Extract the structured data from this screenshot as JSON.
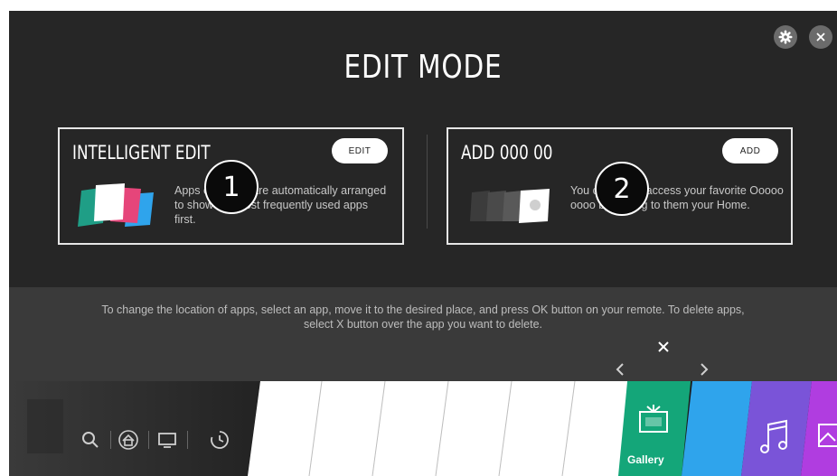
{
  "header": {
    "title": "EDIT MODE",
    "settings_icon": "gear-icon",
    "close_icon": "close-icon"
  },
  "cards": [
    {
      "title": "INTELLIGENT EDIT",
      "button_label": "EDIT",
      "description": "Apps on Home are automatically arranged to show the most frequently used apps first.",
      "badge": "1"
    },
    {
      "title": "ADD 000 00",
      "button_label": "ADD",
      "description": "You can easily access your favorite Ooooo oooo by adding to them your Home.",
      "badge": "2"
    }
  ],
  "instructions": "To change the location of apps, select an app, move it to the desired place, and press OK button on your remote. To delete apps, select X button over the app you want to delete.",
  "launcher": {
    "nav_icons": [
      "search-icon",
      "home-icon",
      "tv-icon",
      "history-icon"
    ],
    "selected_tile_label": "Gallery",
    "selected_tile_icon": "gallery-icon",
    "delete_icon": "close-icon",
    "move_left_icon": "chevron-left-icon",
    "move_right_icon": "chevron-right-icon",
    "next_tile_icon": "music-icon"
  },
  "colors": {
    "selected_tile": "#14a679",
    "tile_blue": "#2fa4ec",
    "tile_purple": "#7a54d8",
    "tile_magenta": "#b03de0"
  }
}
